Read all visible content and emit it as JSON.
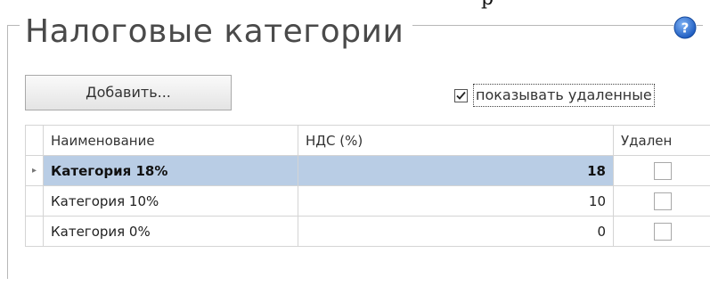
{
  "page": {
    "clipped_text": "р",
    "title": "Налоговые категории",
    "help_icon": "help-icon"
  },
  "toolbar": {
    "add_label": "Добавить...",
    "show_deleted_label": "показывать удаленные",
    "show_deleted_checked": true
  },
  "grid": {
    "columns": [
      "Наименование",
      "НДС (%)",
      "Удален"
    ],
    "rows": [
      {
        "name": "Категория 18%",
        "vat": "18",
        "deleted": false,
        "selected": true
      },
      {
        "name": "Категория 10%",
        "vat": "10",
        "deleted": false,
        "selected": false
      },
      {
        "name": "Категория 0%",
        "vat": "0",
        "deleted": false,
        "selected": false
      }
    ],
    "selected_marker": "▸"
  },
  "colors": {
    "selection": "#b9cde5",
    "help_icon_blue": "#2a6fd0"
  }
}
